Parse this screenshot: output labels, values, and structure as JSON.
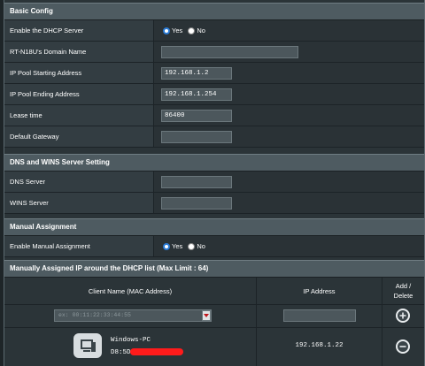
{
  "basic": {
    "title": "Basic Config",
    "dhcp_label": "Enable the DHCP Server",
    "dhcp_yes": "Yes",
    "dhcp_no": "No",
    "dhcp_selected": "Yes",
    "domain_label": "RT-N18U's Domain Name",
    "domain_value": "",
    "pool_start_label": "IP Pool Starting Address",
    "pool_start_value": "192.168.1.2",
    "pool_end_label": "IP Pool Ending Address",
    "pool_end_value": "192.168.1.254",
    "lease_label": "Lease time",
    "lease_value": "86400",
    "gateway_label": "Default Gateway",
    "gateway_value": ""
  },
  "dns": {
    "title": "DNS and WINS Server Setting",
    "dns_label": "DNS Server",
    "dns_value": "",
    "wins_label": "WINS Server",
    "wins_value": ""
  },
  "manual": {
    "title": "Manual Assignment",
    "enable_label": "Enable Manual Assignment",
    "yes": "Yes",
    "no": "No",
    "selected": "Yes"
  },
  "list": {
    "title": "Manually Assigned IP around the DHCP list (Max Limit : 64)",
    "col_client": "Client Name (MAC Address)",
    "col_ip": "IP Address",
    "col_action": "Add / Delete",
    "new_client_placeholder": "ex: 00:11:22:33:44:55",
    "new_ip_value": "",
    "entries": [
      {
        "name": "Windows-PC",
        "mac": "D8:5D",
        "ip": "192.168.1.22"
      }
    ]
  },
  "icons": {
    "add": "plus-circle-icon",
    "delete": "minus-circle-icon",
    "client": "computer-icon",
    "dropdown": "chevron-down-icon"
  },
  "colors": {
    "accent": "#2a7bd6",
    "redaction": "#ff1b1b"
  }
}
